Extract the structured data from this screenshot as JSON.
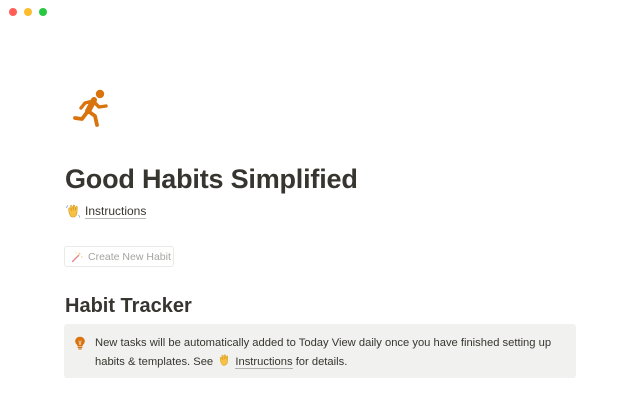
{
  "window": {
    "traffic_lights": [
      {
        "name": "close",
        "color": "#ff5f57"
      },
      {
        "name": "minimize",
        "color": "#febc2e"
      },
      {
        "name": "zoom",
        "color": "#28c840"
      }
    ]
  },
  "page": {
    "icon": "running-person-icon",
    "icon_color": "#d9730d",
    "title": "Good Habits Simplified"
  },
  "instructions_link": {
    "icon": "waving-hand-icon",
    "label": "Instructions"
  },
  "create_button": {
    "icon": "magic-wand-icon",
    "label": "Create New Habit"
  },
  "section": {
    "heading": "Habit Tracker"
  },
  "callout": {
    "icon": "lightbulb-icon",
    "icon_color": "#d9730d",
    "background": "#f1f1ef",
    "text_before": "New tasks will be automatically added to Today View daily once you have finished setting up habits & templates. See ",
    "link_label": "Instructions",
    "text_after": " for details."
  }
}
